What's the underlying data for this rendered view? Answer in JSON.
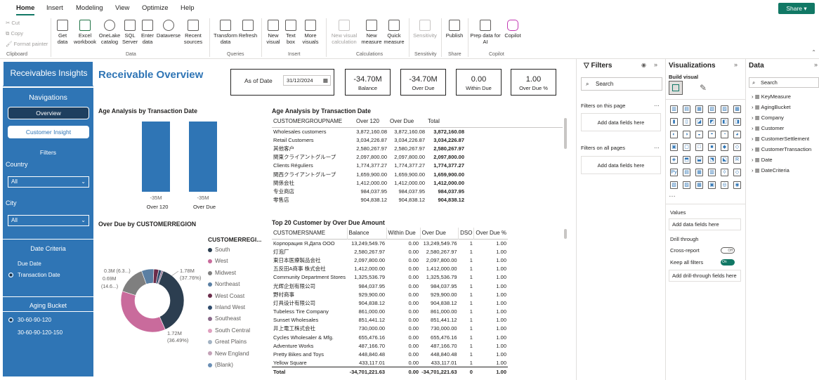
{
  "menu": {
    "tabs": [
      "Home",
      "Insert",
      "Modeling",
      "View",
      "Optimize",
      "Help"
    ],
    "share": "Share"
  },
  "ribbon": {
    "clipboard": {
      "cut": "Cut",
      "copy": "Copy",
      "format_painter": "Format painter",
      "group": "Clipboard"
    },
    "data_group": "Data",
    "data_buttons": [
      "Get data",
      "Excel workbook",
      "OneLake catalog",
      "SQL Server",
      "Enter data",
      "Dataverse",
      "Recent sources"
    ],
    "queries_group": "Queries",
    "queries_buttons": [
      "Transform data",
      "Refresh"
    ],
    "insert_group": "Insert",
    "insert_buttons": [
      "New visual",
      "Text box",
      "More visuals"
    ],
    "calc_group": "Calculations",
    "calc_buttons": [
      "New visual calculation",
      "New measure",
      "Quick measure"
    ],
    "sens_group": "Sensitivity",
    "sens_buttons": [
      "Sensitivity"
    ],
    "share_group": "Share",
    "share_buttons": [
      "Publish"
    ],
    "copilot_group": "Copilot",
    "copilot_buttons": [
      "Prep data for AI",
      "Copilot"
    ]
  },
  "left": {
    "title": "Receivables Insights",
    "nav_title": "Navigations",
    "overview": "Overview",
    "customer_insight": "Customer Insight",
    "filters": "Filters",
    "country_label": "Country",
    "country_value": "All",
    "city_label": "City",
    "city_value": "All",
    "date_criteria": "Date Criteria",
    "due_date": "Due Date",
    "transaction_date": "Transaction Date",
    "aging_bucket": "Aging Bucket",
    "bucket1": "30-60-90-120",
    "bucket2": "30-60-90-120-150"
  },
  "header": {
    "page_title": "Receivable Overview",
    "as_of_label": "As of Date",
    "as_of_value": "31/12/2024"
  },
  "cards": [
    {
      "value": "-34.70M",
      "caption": "Balance"
    },
    {
      "value": "-34.70M",
      "caption": "Over Due"
    },
    {
      "value": "0.00",
      "caption": "Within Due"
    },
    {
      "value": "1.00",
      "caption": "Over Due %"
    }
  ],
  "age_chart": {
    "title": "Age Analysis by Transaction Date",
    "bars": [
      {
        "label": "Over 120",
        "value_label": "-35M"
      },
      {
        "label": "Over Due",
        "value_label": "-35M"
      }
    ]
  },
  "chart_data": {
    "type": "bar",
    "categories": [
      "Over 120",
      "Over Due"
    ],
    "values": [
      -35,
      -35
    ],
    "title": "Age Analysis by Transaction Date",
    "ylabel": ""
  },
  "donut": {
    "title": "Over Due by CUSTOMERREGION",
    "legend_title": "CUSTOMERREGI...",
    "legend": [
      {
        "name": "South",
        "color": "#2c3e50"
      },
      {
        "name": "West",
        "color": "#c96b9c"
      },
      {
        "name": "Midwest",
        "color": "#7f7f7f"
      },
      {
        "name": "Northeast",
        "color": "#5a7fa3"
      },
      {
        "name": "West Coast",
        "color": "#6b2c4a"
      },
      {
        "name": "Inland West",
        "color": "#2e4a6b"
      },
      {
        "name": "Southeast",
        "color": "#8a6a8a"
      },
      {
        "name": "South Central",
        "color": "#e0a0bf"
      },
      {
        "name": "Great Plains",
        "color": "#a3b3c3"
      },
      {
        "name": "New England",
        "color": "#c4a3b8"
      },
      {
        "name": "(Blank)",
        "color": "#6b8fb5"
      }
    ],
    "labels": {
      "south_value": "1.78M",
      "south_pct": "(37.76%)",
      "west_value": "1.72M",
      "west_pct": "(36.49%)",
      "l1": "0.3M (6.3...)",
      "l2": "0.69M",
      "l3": "(14.6...)"
    },
    "slices": [
      37.76,
      36.49,
      14.6,
      6.3,
      2.5,
      1.5,
      0.85
    ]
  },
  "table1": {
    "title": "Age Analysis by Transaction Date",
    "columns": [
      "CUSTOMERGROUPNAME",
      "Over 120",
      "Over Due",
      "Total"
    ],
    "rows": [
      [
        "Wholesales customers",
        "3,872,160.08",
        "3,872,160.08",
        "3,872,160.08"
      ],
      [
        "Retail Customers",
        "3,034,226.87",
        "3,034,226.87",
        "3,034,226.87"
      ],
      [
        "其他客户",
        "2,580,267.97",
        "2,580,267.97",
        "2,580,267.97"
      ],
      [
        "関東クライアントグループ",
        "2,097,800.00",
        "2,097,800.00",
        "2,097,800.00"
      ],
      [
        "Clients Réguliers",
        "1,774,377.27",
        "1,774,377.27",
        "1,774,377.27"
      ],
      [
        "関西クライアントグループ",
        "1,659,900.00",
        "1,659,900.00",
        "1,659,900.00"
      ],
      [
        "関係会社",
        "1,412,000.00",
        "1,412,000.00",
        "1,412,000.00"
      ],
      [
        "专业商店",
        "984,037.95",
        "984,037.95",
        "984,037.95"
      ],
      [
        "零售店",
        "904,838.12",
        "904,838.12",
        "904,838.12"
      ]
    ]
  },
  "table2": {
    "title": "Top 20 Customer by Over Due Amount",
    "columns": [
      "CUSTOMERSNAME",
      "Balance",
      "Within Due",
      "Over Due",
      "DSO",
      "Over Due %"
    ],
    "rows": [
      [
        "Корпорация Я.Дата ООО",
        "13,249,549.76",
        "0.00",
        "13,249,549.76",
        "1",
        "1.00"
      ],
      [
        "灯泡厂",
        "2,580,267.97",
        "0.00",
        "2,580,267.97",
        "1",
        "1.00"
      ],
      [
        "東日本医療製品会社",
        "2,097,800.00",
        "0.00",
        "2,097,800.00",
        "1",
        "1.00"
      ],
      [
        "五反田A商事 株式会社",
        "1,412,000.00",
        "0.00",
        "1,412,000.00",
        "1",
        "1.00"
      ],
      [
        "Community Department Stores",
        "1,325,536.79",
        "0.00",
        "1,325,536.79",
        "1",
        "1.00"
      ],
      [
        "光辉企划有限公司",
        "984,037.95",
        "0.00",
        "984,037.95",
        "1",
        "1.00"
      ],
      [
        "野村商事",
        "929,900.00",
        "0.00",
        "929,900.00",
        "1",
        "1.00"
      ],
      [
        "灯具设计有限公司",
        "904,838.12",
        "0.00",
        "904,838.12",
        "1",
        "1.00"
      ],
      [
        "Tubeless Tire Company",
        "861,000.00",
        "0.00",
        "861,000.00",
        "1",
        "1.00"
      ],
      [
        "Sunset Wholesales",
        "851,441.12",
        "0.00",
        "851,441.12",
        "1",
        "1.00"
      ],
      [
        "井上電工株式会社",
        "730,000.00",
        "0.00",
        "730,000.00",
        "1",
        "1.00"
      ],
      [
        "Cycles Wholesaler & Mfg.",
        "655,476.16",
        "0.00",
        "655,476.16",
        "1",
        "1.00"
      ],
      [
        "Adventure Works",
        "487,166.70",
        "0.00",
        "487,166.70",
        "1",
        "1.00"
      ],
      [
        "Pretty Bikes and Toys",
        "448,840.48",
        "0.00",
        "448,840.48",
        "1",
        "1.00"
      ],
      [
        "Yellow Square",
        "433,117.01",
        "0.00",
        "433,117.01",
        "1",
        "1.00"
      ]
    ],
    "total": [
      "Total",
      "-34,701,221.63",
      "0.00",
      "-34,701,221.63",
      "0",
      "1.00"
    ]
  },
  "filters_pane": {
    "title": "Filters",
    "search": "Search",
    "on_page": "Filters on this page",
    "on_all": "Filters on all pages",
    "add": "Add data fields here"
  },
  "viz_pane": {
    "title": "Visualizations",
    "build": "Build visual",
    "values": "Values",
    "add_values": "Add data fields here",
    "drill": "Drill through",
    "cross_report": "Cross-report",
    "cross_state": "Off",
    "keep_filters": "Keep all filters",
    "keep_state": "On",
    "add_drill": "Add drill-through fields here"
  },
  "data_pane": {
    "title": "Data",
    "search": "Search",
    "fields": [
      "KeyMeasure",
      "AgingBucket",
      "Company",
      "Customer",
      "CustomerSettlement",
      "CustomerTransaction",
      "Date",
      "DateCriteria"
    ]
  },
  "colors": {
    "accent": "#117865",
    "nav": "#2f75b5",
    "bar": "#2f75b5",
    "title": "#2f75b5"
  }
}
